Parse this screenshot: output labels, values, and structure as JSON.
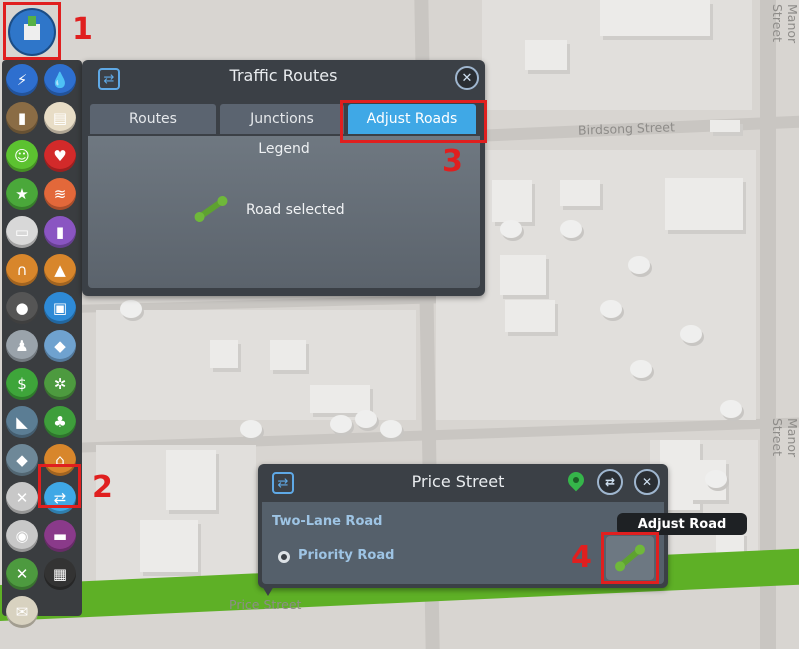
{
  "map": {
    "street_labels": [
      "Birdsong Street",
      "Price Street",
      "Manor Street",
      "Manor Street"
    ]
  },
  "toolbar": {
    "top_button_icon": "zoom-to-city-icon",
    "buttons": [
      {
        "icon": "electricity-icon",
        "color": "#2e6fcf"
      },
      {
        "icon": "water-icon",
        "color": "#2e6fcf"
      },
      {
        "icon": "garbage-icon",
        "color": "#8a6c45"
      },
      {
        "icon": "education-icon",
        "color": "#e8ddc6"
      },
      {
        "icon": "happiness-icon",
        "color": "#5cc230"
      },
      {
        "icon": "health-icon",
        "color": "#d22a2a"
      },
      {
        "icon": "landvalue-icon",
        "color": "#4aa83a"
      },
      {
        "icon": "wind-icon",
        "color": "#e3683a"
      },
      {
        "icon": "traffic-icon",
        "color": "#d8d8d8"
      },
      {
        "icon": "pollution-icon",
        "color": "#8a55c2"
      },
      {
        "icon": "noise-icon",
        "color": "#d8862b"
      },
      {
        "icon": "fire-icon",
        "color": "#d8862b"
      },
      {
        "icon": "crime-icon",
        "color": "#555555"
      },
      {
        "icon": "transport-icon",
        "color": "#2e8ad6"
      },
      {
        "icon": "population-icon",
        "color": "#9aa3ab"
      },
      {
        "icon": "heating-icon",
        "color": "#6fa2cf"
      },
      {
        "icon": "economy-icon",
        "color": "#3ea53a"
      },
      {
        "icon": "resources-icon",
        "color": "#4d9a3f"
      },
      {
        "icon": "tourism-icon",
        "color": "#5b7d94"
      },
      {
        "icon": "natural-resources-icon",
        "color": "#3e9e3b"
      },
      {
        "icon": "terrain-icon",
        "color": "#6e8898"
      },
      {
        "icon": "maintenance-icon",
        "color": "#d8862b"
      },
      {
        "icon": "tools-icon",
        "color": "#c8c8c8"
      },
      {
        "icon": "traffic-routes-icon",
        "color": "#3fa8e6"
      },
      {
        "icon": "tourist-icon",
        "color": "#c8c8c8"
      },
      {
        "icon": "ferry-icon",
        "color": "#8a3a8a"
      },
      {
        "icon": "road-maintenance-icon",
        "color": "#4d9a3f"
      },
      {
        "icon": "industry-icon",
        "color": "#333333"
      },
      {
        "icon": "mail-icon",
        "color": "#d8d2c0"
      }
    ]
  },
  "annotations": [
    "1",
    "2",
    "3",
    "4"
  ],
  "traffic_panel": {
    "title": "Traffic Routes",
    "tabs": [
      "Routes",
      "Junctions",
      "Adjust Roads"
    ],
    "active_tab": "Adjust Roads",
    "legend_title": "Legend",
    "legend_item": "Road selected"
  },
  "info_panel": {
    "title": "Price Street",
    "road_type": "Two-Lane Road",
    "priority_label": "Priority Road",
    "tooltip": "Adjust Road"
  }
}
